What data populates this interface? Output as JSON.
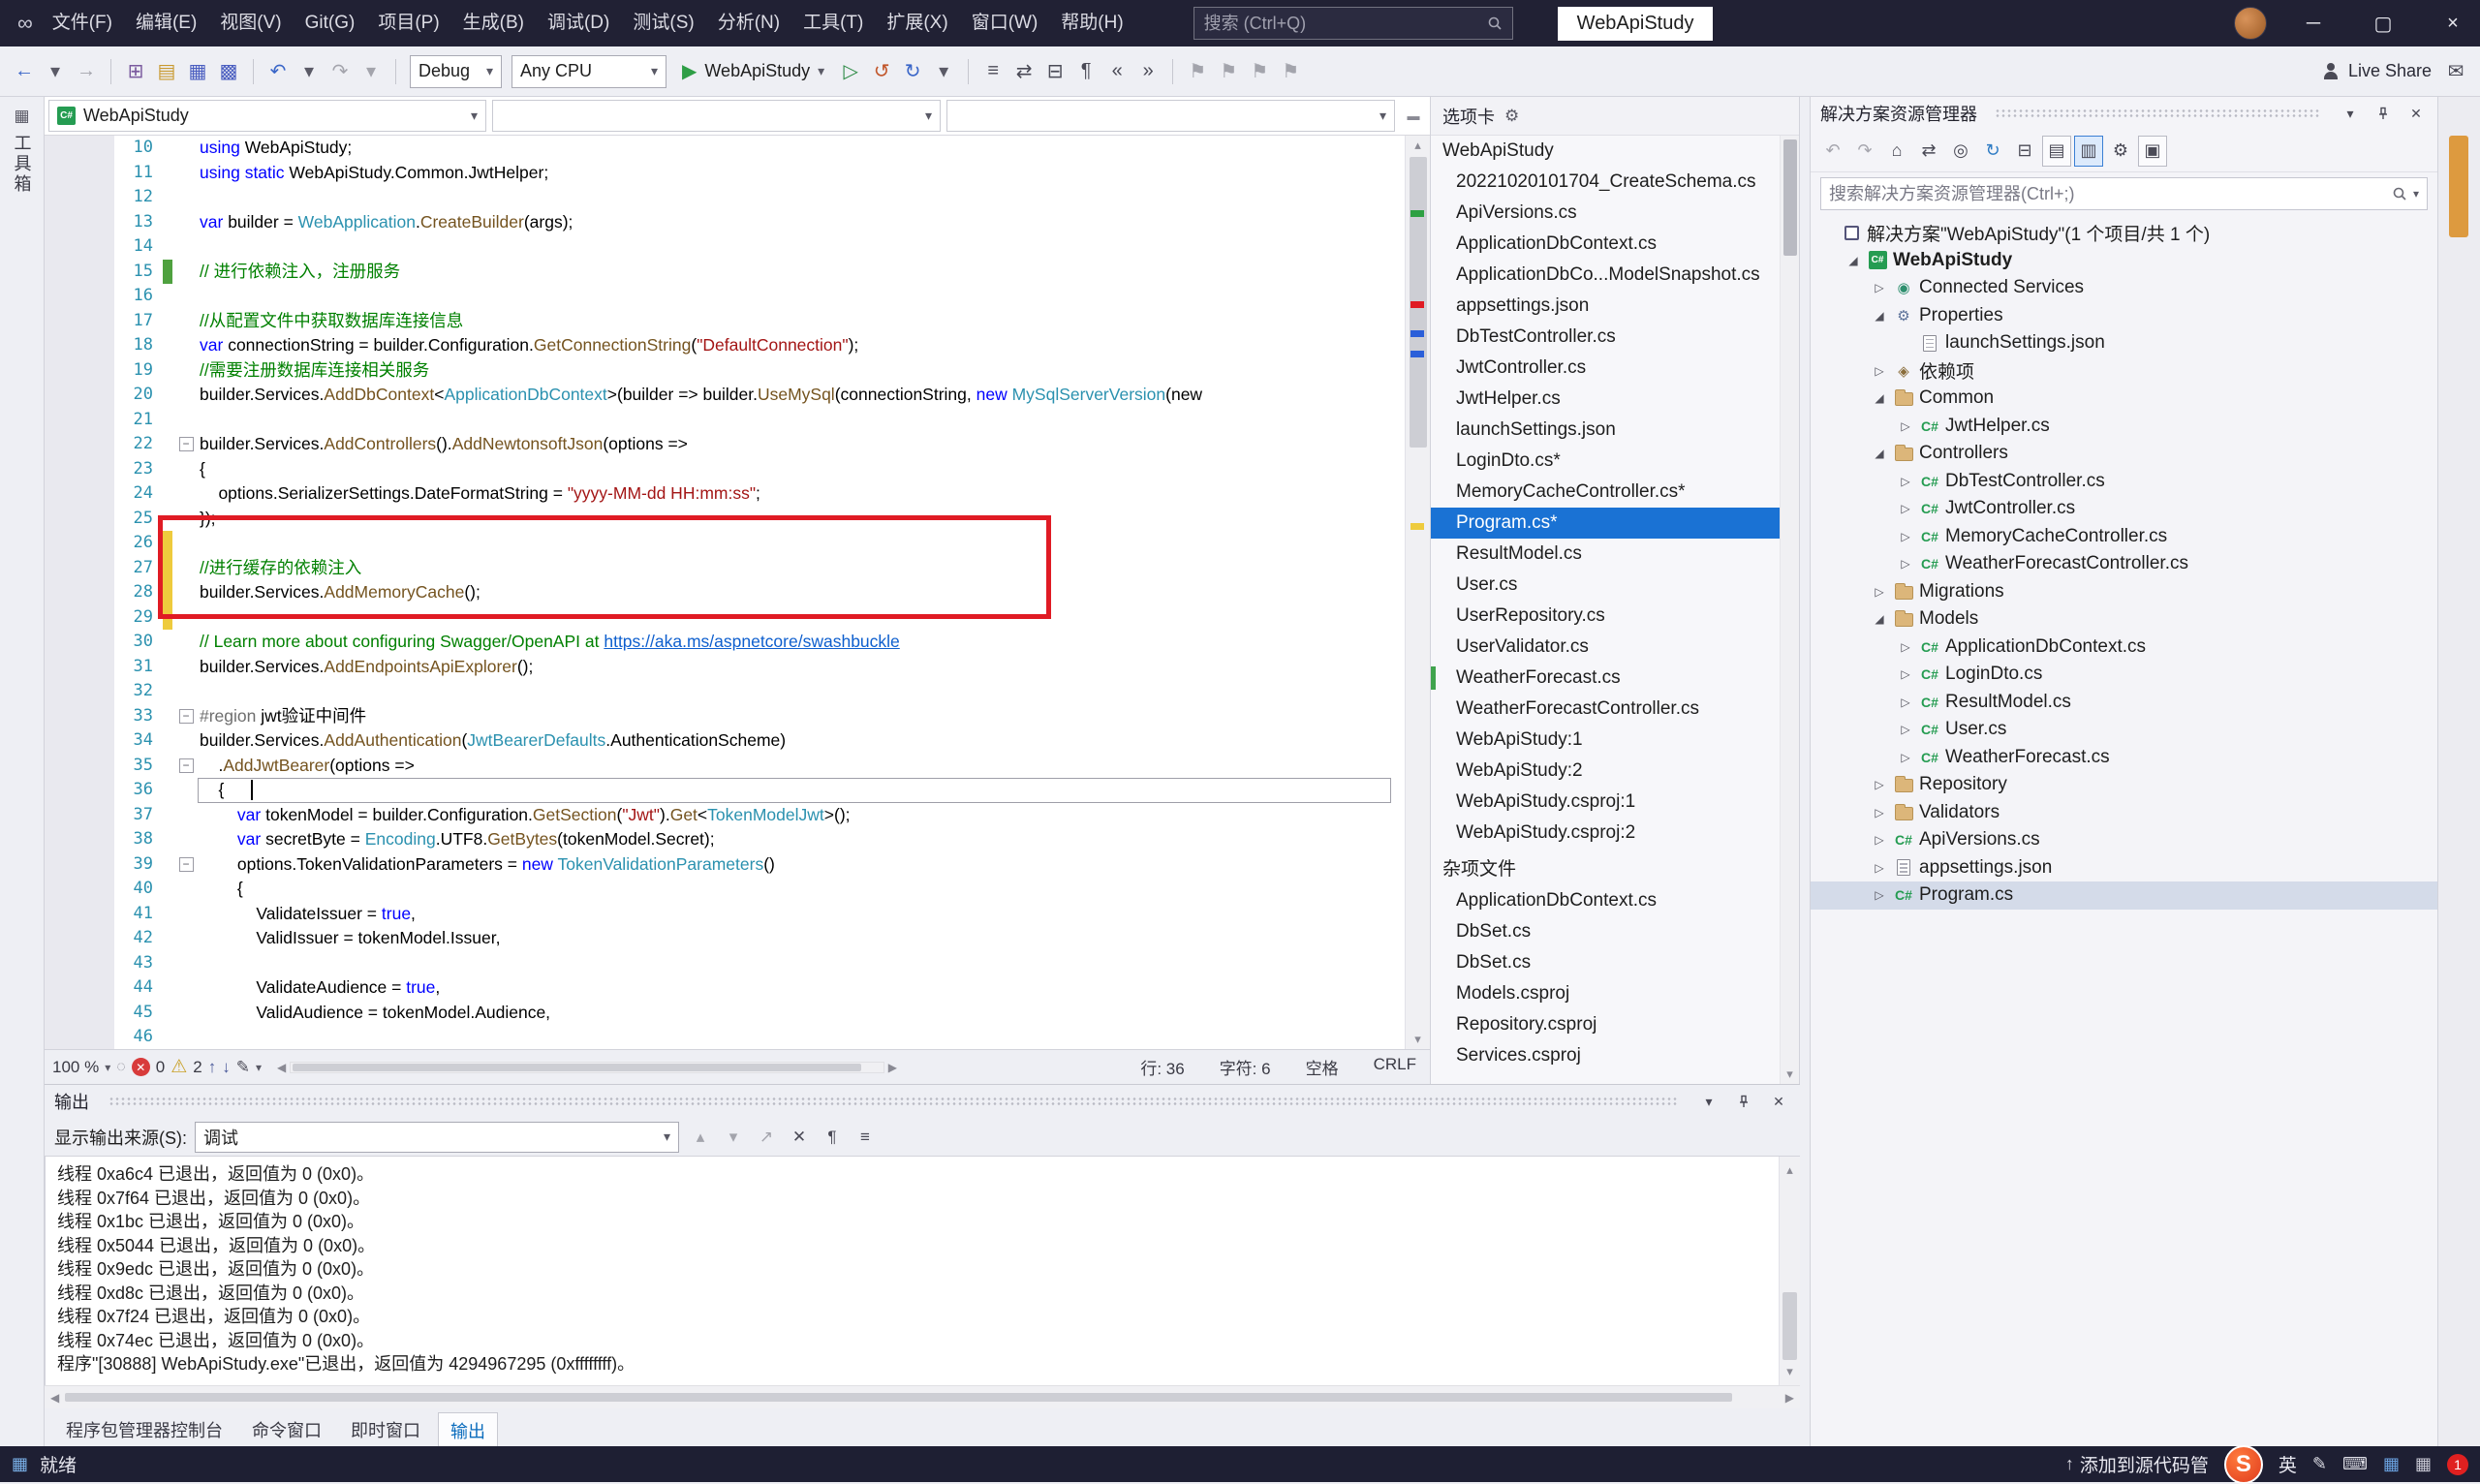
{
  "title_bar": {
    "menus": [
      "文件(F)",
      "编辑(E)",
      "视图(V)",
      "Git(G)",
      "项目(P)",
      "生成(B)",
      "调试(D)",
      "测试(S)",
      "分析(N)",
      "工具(T)",
      "扩展(X)",
      "窗口(W)",
      "帮助(H)"
    ],
    "search_placeholder": "搜索 (Ctrl+Q)",
    "window_title": "WebApiStudy"
  },
  "toolbar": {
    "icons_left": [
      {
        "n": "navigate-back-icon",
        "g": "←",
        "c": "#3a66c8"
      },
      {
        "n": "navigate-back-menu-icon",
        "g": "▾",
        "c": "#5a5a66"
      },
      {
        "n": "navigate-forward-icon",
        "g": "→",
        "dim": true
      },
      {
        "n": "sep"
      },
      {
        "n": "new-project-icon",
        "g": "⊞",
        "c": "#7a5a9e"
      },
      {
        "n": "open-file-icon",
        "g": "▤",
        "c": "#c8992e"
      },
      {
        "n": "save-icon",
        "g": "▦",
        "c": "#4a5ec0"
      },
      {
        "n": "save-all-icon",
        "g": "▩",
        "c": "#4a5ec0"
      },
      {
        "n": "sep"
      },
      {
        "n": "undo-icon",
        "g": "↶",
        "c": "#3a66c8"
      },
      {
        "n": "undo-menu-icon",
        "g": "▾",
        "c": "#5a5a66"
      },
      {
        "n": "redo-icon",
        "g": "↷",
        "dim": true
      },
      {
        "n": "redo-menu-icon",
        "g": "▾",
        "dim": true
      },
      {
        "n": "sep"
      }
    ],
    "debug_config": "Debug",
    "platform": "Any CPU",
    "run_label": "WebApiStudy",
    "icons_right": [
      {
        "n": "start-without-debugging-icon",
        "g": "▷",
        "c": "#2e8b46"
      },
      {
        "n": "hot-reload-icon",
        "g": "↺",
        "c": "#c2572c"
      },
      {
        "n": "restart-app-icon",
        "g": "↻",
        "c": "#3a66c8"
      },
      {
        "n": "restart-menu-icon",
        "g": "▾",
        "c": "#5a5a66"
      },
      {
        "n": "sep"
      },
      {
        "n": "find-in-files-icon",
        "g": "≡"
      },
      {
        "n": "navigate-symbols-icon",
        "g": "⇄"
      },
      {
        "n": "collapse-regions-icon",
        "g": "⊟"
      },
      {
        "n": "format-document-icon",
        "g": "¶"
      },
      {
        "n": "outdent-icon",
        "g": "«"
      },
      {
        "n": "indent-icon",
        "g": "»"
      },
      {
        "n": "sep"
      },
      {
        "n": "bookmark-toggle-icon",
        "g": "⚑",
        "dim": true
      },
      {
        "n": "bookmark-prev-icon",
        "g": "⚑",
        "dim": true
      },
      {
        "n": "bookmark-next-icon",
        "g": "⚑",
        "dim": true
      },
      {
        "n": "bookmark-clear-icon",
        "g": "⚑",
        "dim": true
      }
    ],
    "live_share": "Live Share"
  },
  "left_rail": {
    "toolbox": "工具箱"
  },
  "editor": {
    "nav": {
      "project": "WebApiStudy"
    },
    "red_box": {
      "from_line": 26,
      "to_line": 29
    },
    "cursor": {
      "line": 36,
      "col": 6
    },
    "lines": [
      {
        "n": 10,
        "seg": [
          [
            "k",
            "using "
          ],
          [
            "p",
            "WebApiStudy;"
          ]
        ]
      },
      {
        "n": 11,
        "seg": [
          [
            "k",
            "using static "
          ],
          [
            "p",
            "WebApiStudy.Common.JwtHelper;"
          ]
        ]
      },
      {
        "n": 12,
        "seg": []
      },
      {
        "n": 13,
        "seg": [
          [
            "k",
            "var "
          ],
          [
            "p",
            "builder = "
          ],
          [
            "t",
            "WebApplication"
          ],
          [
            "p",
            "."
          ],
          [
            "m",
            "CreateBuilder"
          ],
          [
            "p",
            "(args);"
          ]
        ]
      },
      {
        "n": 14,
        "seg": []
      },
      {
        "n": 15,
        "m": "g",
        "seg": [
          [
            "c",
            "// 进行依赖注入，注册服务"
          ]
        ]
      },
      {
        "n": 16,
        "seg": []
      },
      {
        "n": 17,
        "seg": [
          [
            "c",
            "//从配置文件中获取数据库连接信息"
          ]
        ]
      },
      {
        "n": 18,
        "seg": [
          [
            "k",
            "var "
          ],
          [
            "p",
            "connectionString = builder.Configuration."
          ],
          [
            "m",
            "GetConnectionString"
          ],
          [
            "p",
            "("
          ],
          [
            "s",
            "\"DefaultConnection\""
          ],
          [
            "p",
            ");"
          ]
        ]
      },
      {
        "n": 19,
        "seg": [
          [
            "c",
            "//需要注册数据库连接相关服务"
          ]
        ]
      },
      {
        "n": 20,
        "seg": [
          [
            "p",
            "builder.Services."
          ],
          [
            "m",
            "AddDbContext"
          ],
          [
            "p",
            "<"
          ],
          [
            "t",
            "ApplicationDbContext"
          ],
          [
            "p",
            ">(builder => builder."
          ],
          [
            "m",
            "UseMySql"
          ],
          [
            "p",
            "(connectionString, "
          ],
          [
            "k",
            "new "
          ],
          [
            "t",
            "MySqlServerVersion"
          ],
          [
            "p",
            "(new"
          ]
        ]
      },
      {
        "n": 21,
        "seg": []
      },
      {
        "n": 22,
        "f": true,
        "seg": [
          [
            "p",
            "builder.Services."
          ],
          [
            "m",
            "AddControllers"
          ],
          [
            "p",
            "()."
          ],
          [
            "m",
            "AddNewtonsoftJson"
          ],
          [
            "p",
            "(options =>"
          ]
        ]
      },
      {
        "n": 23,
        "seg": [
          [
            "p",
            "{"
          ]
        ]
      },
      {
        "n": 24,
        "seg": [
          [
            "p",
            "    options.SerializerSettings.DateFormatString = "
          ],
          [
            "s",
            "\"yyyy-MM-dd HH:mm:ss\""
          ],
          [
            "p",
            ";"
          ]
        ]
      },
      {
        "n": 25,
        "seg": [
          [
            "p",
            "});"
          ]
        ]
      },
      {
        "n": 26,
        "m": "y",
        "seg": []
      },
      {
        "n": 27,
        "m": "y",
        "seg": [
          [
            "c",
            "//进行缓存的依赖注入"
          ]
        ]
      },
      {
        "n": 28,
        "m": "y",
        "seg": [
          [
            "p",
            "builder.Services."
          ],
          [
            "m",
            "AddMemoryCache"
          ],
          [
            "p",
            "();"
          ]
        ]
      },
      {
        "n": 29,
        "m": "y",
        "seg": []
      },
      {
        "n": 30,
        "seg": [
          [
            "c",
            "// Learn more about configuring Swagger/OpenAPI at "
          ],
          [
            "u",
            "https://aka.ms/aspnetcore/swashbuckle"
          ]
        ]
      },
      {
        "n": 31,
        "seg": [
          [
            "p",
            "builder.Services."
          ],
          [
            "m",
            "AddEndpointsApiExplorer"
          ],
          [
            "p",
            "();"
          ]
        ]
      },
      {
        "n": 32,
        "seg": []
      },
      {
        "n": 33,
        "f": true,
        "seg": [
          [
            "d",
            "#region"
          ],
          [
            "p",
            " jwt验证中间件"
          ]
        ]
      },
      {
        "n": 34,
        "seg": [
          [
            "p",
            "builder.Services."
          ],
          [
            "m",
            "AddAuthentication"
          ],
          [
            "p",
            "("
          ],
          [
            "t",
            "JwtBearerDefaults"
          ],
          [
            "p",
            ".AuthenticationScheme)"
          ]
        ]
      },
      {
        "n": 35,
        "f": true,
        "seg": [
          [
            "p",
            "    ."
          ],
          [
            "m",
            "AddJwtBearer"
          ],
          [
            "p",
            "(options =>"
          ]
        ]
      },
      {
        "n": 36,
        "seg": [
          [
            "p",
            "    {"
          ]
        ]
      },
      {
        "n": 37,
        "seg": [
          [
            "p",
            "        "
          ],
          [
            "k",
            "var "
          ],
          [
            "p",
            "tokenModel = builder.Configuration."
          ],
          [
            "m",
            "GetSection"
          ],
          [
            "p",
            "("
          ],
          [
            "s",
            "\"Jwt\""
          ],
          [
            "p",
            ")."
          ],
          [
            "m",
            "Get"
          ],
          [
            "p",
            "<"
          ],
          [
            "t",
            "TokenModelJwt"
          ],
          [
            "p",
            ">();"
          ]
        ]
      },
      {
        "n": 38,
        "seg": [
          [
            "p",
            "        "
          ],
          [
            "k",
            "var "
          ],
          [
            "p",
            "secretByte = "
          ],
          [
            "t",
            "Encoding"
          ],
          [
            "p",
            ".UTF8."
          ],
          [
            "m",
            "GetBytes"
          ],
          [
            "p",
            "(tokenModel.Secret);"
          ]
        ]
      },
      {
        "n": 39,
        "f": true,
        "seg": [
          [
            "p",
            "        options.TokenValidationParameters = "
          ],
          [
            "k",
            "new "
          ],
          [
            "t",
            "TokenValidationParameters"
          ],
          [
            "p",
            "()"
          ]
        ]
      },
      {
        "n": 40,
        "seg": [
          [
            "p",
            "        {"
          ]
        ]
      },
      {
        "n": 41,
        "seg": [
          [
            "p",
            "            ValidateIssuer = "
          ],
          [
            "k",
            "true"
          ],
          [
            "p",
            ","
          ]
        ]
      },
      {
        "n": 42,
        "seg": [
          [
            "p",
            "            ValidIssuer = tokenModel.Issuer,"
          ]
        ]
      },
      {
        "n": 43,
        "seg": []
      },
      {
        "n": 44,
        "seg": [
          [
            "p",
            "            ValidateAudience = "
          ],
          [
            "k",
            "true"
          ],
          [
            "p",
            ","
          ]
        ]
      },
      {
        "n": 45,
        "seg": [
          [
            "p",
            "            ValidAudience = tokenModel.Audience,"
          ]
        ]
      },
      {
        "n": 46,
        "seg": []
      }
    ],
    "status": {
      "zoom": "100 %",
      "errors": "0",
      "warnings": "2",
      "line": "行: 36",
      "column": "字符: 6",
      "spaces": "空格",
      "line_ending": "CRLF"
    }
  },
  "tabs_panel": {
    "title": "选项卡",
    "group": "WebApiStudy",
    "items": [
      {
        "label": "20221020101704_CreateSchema.cs"
      },
      {
        "label": "ApiVersions.cs"
      },
      {
        "label": "ApplicationDbContext.cs"
      },
      {
        "label": "ApplicationDbCo...ModelSnapshot.cs"
      },
      {
        "label": "appsettings.json"
      },
      {
        "label": "DbTestController.cs"
      },
      {
        "label": "JwtController.cs"
      },
      {
        "label": "JwtHelper.cs"
      },
      {
        "label": "launchSettings.json"
      },
      {
        "label": "LoginDto.cs*"
      },
      {
        "label": "MemoryCacheController.cs*"
      },
      {
        "label": "Program.cs*",
        "selected": true
      },
      {
        "label": "ResultModel.cs"
      },
      {
        "label": "User.cs"
      },
      {
        "label": "UserRepository.cs"
      },
      {
        "label": "UserValidator.cs"
      },
      {
        "label": "WeatherForecast.cs",
        "marker": true
      },
      {
        "label": "WeatherForecastController.cs"
      },
      {
        "label": "WebApiStudy:1"
      },
      {
        "label": "WebApiStudy:2"
      },
      {
        "label": "WebApiStudy.csproj:1"
      },
      {
        "label": "WebApiStudy.csproj:2"
      }
    ],
    "misc_group": "杂项文件",
    "misc_items": [
      {
        "label": "ApplicationDbContext.cs"
      },
      {
        "label": "DbSet.cs"
      },
      {
        "label": "DbSet.cs"
      },
      {
        "label": "Models.csproj"
      },
      {
        "label": "Repository.csproj"
      },
      {
        "label": "Services.csproj"
      }
    ]
  },
  "solution_explorer": {
    "title": "解决方案资源管理器",
    "search_placeholder": "搜索解决方案资源管理器(Ctrl+;)",
    "tools": [
      {
        "n": "nav-back-icon",
        "g": "↶",
        "dim": true
      },
      {
        "n": "nav-forward-icon",
        "g": "↷",
        "dim": true
      },
      {
        "n": "home-icon",
        "g": "⌂"
      },
      {
        "n": "switch-views-icon",
        "g": "⇄"
      },
      {
        "n": "sync-with-active-document-icon",
        "g": "◎"
      },
      {
        "n": "refresh-icon",
        "g": "↻",
        "c": "#2f7cc4"
      },
      {
        "n": "collapse-all-icon",
        "g": "⊟"
      },
      {
        "n": "show-all-files-toggle-icon",
        "g": "▤",
        "boxed": true
      },
      {
        "n": "preview-selected-items-toggle-icon",
        "g": "▥",
        "boxed": true,
        "active": true
      },
      {
        "n": "properties-icon",
        "g": "⚙"
      },
      {
        "n": "attach-toggle-icon",
        "g": "▣",
        "boxed": true
      }
    ],
    "tree": [
      {
        "label": "解决方案\"WebApiStudy\"(1 个项目/共 1 个)",
        "indent": 0,
        "arrow": "",
        "icon": "solution"
      },
      {
        "label": "WebApiStudy",
        "indent": 1,
        "arrow": "e",
        "icon": "project",
        "bold": true
      },
      {
        "label": "Connected Services",
        "indent": 2,
        "arrow": "c",
        "icon": "services"
      },
      {
        "label": "Properties",
        "indent": 2,
        "arrow": "e",
        "icon": "properties"
      },
      {
        "label": "launchSettings.json",
        "indent": 3,
        "arrow": "",
        "icon": "json"
      },
      {
        "label": "依赖项",
        "indent": 2,
        "arrow": "c",
        "icon": "deps"
      },
      {
        "label": "Common",
        "indent": 2,
        "arrow": "e",
        "icon": "folder"
      },
      {
        "label": "JwtHelper.cs",
        "indent": 3,
        "arrow": "c",
        "icon": "cs"
      },
      {
        "label": "Controllers",
        "indent": 2,
        "arrow": "e",
        "icon": "folder"
      },
      {
        "label": "DbTestController.cs",
        "indent": 3,
        "arrow": "c",
        "icon": "cs"
      },
      {
        "label": "JwtController.cs",
        "indent": 3,
        "arrow": "c",
        "icon": "cs"
      },
      {
        "label": "MemoryCacheController.cs",
        "indent": 3,
        "arrow": "c",
        "icon": "cs"
      },
      {
        "label": "WeatherForecastController.cs",
        "indent": 3,
        "arrow": "c",
        "icon": "cs"
      },
      {
        "label": "Migrations",
        "indent": 2,
        "arrow": "c",
        "icon": "folder"
      },
      {
        "label": "Models",
        "indent": 2,
        "arrow": "e",
        "icon": "folder"
      },
      {
        "label": "ApplicationDbContext.cs",
        "indent": 3,
        "arrow": "c",
        "icon": "cs"
      },
      {
        "label": "LoginDto.cs",
        "indent": 3,
        "arrow": "c",
        "icon": "cs"
      },
      {
        "label": "ResultModel.cs",
        "indent": 3,
        "arrow": "c",
        "icon": "cs"
      },
      {
        "label": "User.cs",
        "indent": 3,
        "arrow": "c",
        "icon": "cs"
      },
      {
        "label": "WeatherForecast.cs",
        "indent": 3,
        "arrow": "c",
        "icon": "cs"
      },
      {
        "label": "Repository",
        "indent": 2,
        "arrow": "c",
        "icon": "folder"
      },
      {
        "label": "Validators",
        "indent": 2,
        "arrow": "c",
        "icon": "folder"
      },
      {
        "label": "ApiVersions.cs",
        "indent": 2,
        "arrow": "c",
        "icon": "cs"
      },
      {
        "label": "appsettings.json",
        "indent": 2,
        "arrow": "c",
        "icon": "json"
      },
      {
        "label": "Program.cs",
        "indent": 2,
        "arrow": "c",
        "icon": "cs",
        "selected": true
      }
    ]
  },
  "output": {
    "title": "输出",
    "source_label": "显示输出来源(S):",
    "source_value": "调试",
    "tools": [
      {
        "n": "prev-message-icon",
        "g": "▴",
        "dim": true
      },
      {
        "n": "next-message-icon",
        "g": "▾",
        "dim": true
      },
      {
        "n": "goto-source-icon",
        "g": "↗",
        "dim": true
      },
      {
        "n": "clear-all-icon",
        "g": "✕"
      },
      {
        "n": "word-wrap-icon",
        "g": "¶"
      },
      {
        "n": "toggle-autoscroll-icon",
        "g": "≡"
      }
    ],
    "lines": [
      "线程 0xa6c4 已退出，返回值为 0 (0x0)。",
      "线程 0x7f64 已退出，返回值为 0 (0x0)。",
      "线程 0x1bc 已退出，返回值为 0 (0x0)。",
      "线程 0x5044 已退出，返回值为 0 (0x0)。",
      "线程 0x9edc 已退出，返回值为 0 (0x0)。",
      "线程 0xd8c 已退出，返回值为 0 (0x0)。",
      "线程 0x7f24 已退出，返回值为 0 (0x0)。",
      "线程 0x74ec 已退出，返回值为 0 (0x0)。",
      "程序\"[30888] WebApiStudy.exe\"已退出，返回值为 4294967295 (0xffffffff)。"
    ],
    "tabs": [
      "程序包管理器控制台",
      "命令窗口",
      "即时窗口",
      "输出"
    ],
    "active_tab": "输出"
  },
  "status_bar": {
    "ready": "就绪",
    "source_control": "添加到源代码管",
    "ime": "英",
    "badge": "1"
  }
}
